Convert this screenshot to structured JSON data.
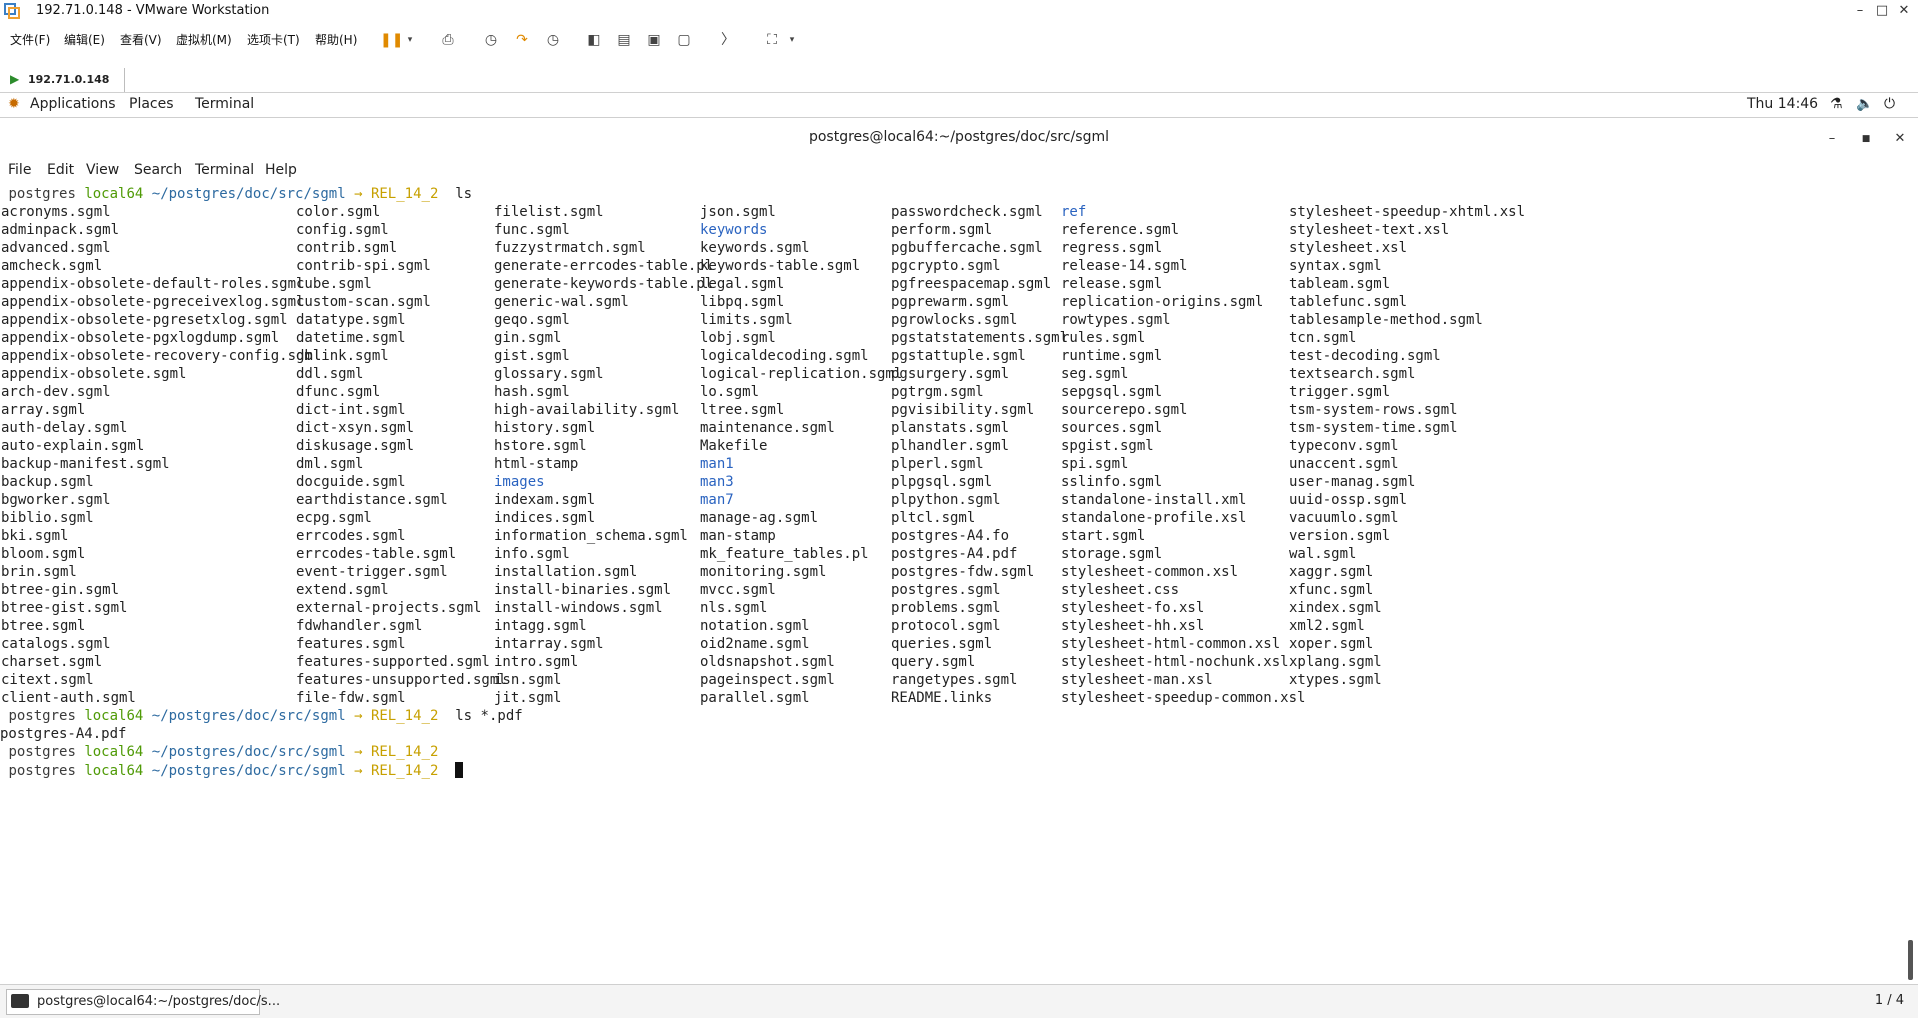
{
  "vmware": {
    "title": "192.71.0.148 - VMware Workstation",
    "menu": [
      "文件(F)",
      "编辑(E)",
      "查看(V)",
      "虚拟机(M)",
      "选项卡(T)",
      "帮助(H)"
    ],
    "tab": "192.71.0.148"
  },
  "gnome": {
    "applications": "Applications",
    "places": "Places",
    "terminal": "Terminal",
    "clock": "Thu 14:46"
  },
  "terminal": {
    "title": "postgres@local64:~/postgres/doc/src/sgml",
    "menu": [
      "File",
      "Edit",
      "View",
      "Search",
      "Terminal",
      "Help"
    ],
    "prompt": {
      "user": "postgres",
      "host": "local64",
      "path": "~/postgres/doc/src/sgml",
      "arrow": "→",
      "branch": "REL_14_2"
    },
    "cmd1": "ls",
    "cmd2": "ls *.pdf",
    "pdf_output": "postgres-A4.pdf",
    "ls_columns": [
      [
        "acronyms.sgml",
        "adminpack.sgml",
        "advanced.sgml",
        "amcheck.sgml",
        "appendix-obsolete-default-roles.sgml",
        "appendix-obsolete-pgreceivexlog.sgml",
        "appendix-obsolete-pgresetxlog.sgml",
        "appendix-obsolete-pgxlogdump.sgml",
        "appendix-obsolete-recovery-config.sgml",
        "appendix-obsolete.sgml",
        "arch-dev.sgml",
        "array.sgml",
        "auth-delay.sgml",
        "auto-explain.sgml",
        "backup-manifest.sgml",
        "backup.sgml",
        "bgworker.sgml",
        "biblio.sgml",
        "bki.sgml",
        "bloom.sgml",
        "brin.sgml",
        "btree-gin.sgml",
        "btree-gist.sgml",
        "btree.sgml",
        "catalogs.sgml",
        "charset.sgml",
        "citext.sgml",
        "client-auth.sgml"
      ],
      [
        "color.sgml",
        "config.sgml",
        "contrib.sgml",
        "contrib-spi.sgml",
        "cube.sgml",
        "custom-scan.sgml",
        "datatype.sgml",
        "datetime.sgml",
        "dblink.sgml",
        "ddl.sgml",
        "dfunc.sgml",
        "dict-int.sgml",
        "dict-xsyn.sgml",
        "diskusage.sgml",
        "dml.sgml",
        "docguide.sgml",
        "earthdistance.sgml",
        "ecpg.sgml",
        "errcodes.sgml",
        "errcodes-table.sgml",
        "event-trigger.sgml",
        "extend.sgml",
        "external-projects.sgml",
        "fdwhandler.sgml",
        "features.sgml",
        "features-supported.sgml",
        "features-unsupported.sgml",
        "file-fdw.sgml"
      ],
      [
        "filelist.sgml",
        "func.sgml",
        "fuzzystrmatch.sgml",
        "generate-errcodes-table.pl",
        "generate-keywords-table.pl",
        "generic-wal.sgml",
        "geqo.sgml",
        "gin.sgml",
        "gist.sgml",
        "glossary.sgml",
        "hash.sgml",
        "high-availability.sgml",
        "history.sgml",
        "hstore.sgml",
        "html-stamp",
        "images",
        "indexam.sgml",
        "indices.sgml",
        "information_schema.sgml",
        "info.sgml",
        "installation.sgml",
        "install-binaries.sgml",
        "install-windows.sgml",
        "intagg.sgml",
        "intarray.sgml",
        "intro.sgml",
        "isn.sgml",
        "jit.sgml"
      ],
      [
        "json.sgml",
        "keywords",
        "keywords.sgml",
        "keywords-table.sgml",
        "legal.sgml",
        "libpq.sgml",
        "limits.sgml",
        "lobj.sgml",
        "logicaldecoding.sgml",
        "logical-replication.sgml",
        "lo.sgml",
        "ltree.sgml",
        "maintenance.sgml",
        "Makefile",
        "man1",
        "man3",
        "man7",
        "manage-ag.sgml",
        "man-stamp",
        "mk_feature_tables.pl",
        "monitoring.sgml",
        "mvcc.sgml",
        "nls.sgml",
        "notation.sgml",
        "oid2name.sgml",
        "oldsnapshot.sgml",
        "pageinspect.sgml",
        "parallel.sgml"
      ],
      [
        "passwordcheck.sgml",
        "perform.sgml",
        "pgbuffercache.sgml",
        "pgcrypto.sgml",
        "pgfreespacemap.sgml",
        "pgprewarm.sgml",
        "pgrowlocks.sgml",
        "pgstatstatements.sgml",
        "pgstattuple.sgml",
        "pgsurgery.sgml",
        "pgtrgm.sgml",
        "pgvisibility.sgml",
        "planstats.sgml",
        "plhandler.sgml",
        "plperl.sgml",
        "plpgsql.sgml",
        "plpython.sgml",
        "pltcl.sgml",
        "postgres-A4.fo",
        "postgres-A4.pdf",
        "postgres-fdw.sgml",
        "postgres.sgml",
        "problems.sgml",
        "protocol.sgml",
        "queries.sgml",
        "query.sgml",
        "rangetypes.sgml",
        "README.links"
      ],
      [
        "ref",
        "reference.sgml",
        "regress.sgml",
        "release-14.sgml",
        "release.sgml",
        "replication-origins.sgml",
        "rowtypes.sgml",
        "rules.sgml",
        "runtime.sgml",
        "seg.sgml",
        "sepgsql.sgml",
        "sourcerepo.sgml",
        "sources.sgml",
        "spgist.sgml",
        "spi.sgml",
        "sslinfo.sgml",
        "standalone-install.xml",
        "standalone-profile.xsl",
        "start.sgml",
        "storage.sgml",
        "stylesheet-common.xsl",
        "stylesheet.css",
        "stylesheet-fo.xsl",
        "stylesheet-hh.xsl",
        "stylesheet-html-common.xsl",
        "stylesheet-html-nochunk.xsl",
        "stylesheet-man.xsl",
        "stylesheet-speedup-common.xsl"
      ],
      [
        "stylesheet-speedup-xhtml.xsl",
        "stylesheet-text.xsl",
        "stylesheet.xsl",
        "syntax.sgml",
        "tableam.sgml",
        "tablefunc.sgml",
        "tablesample-method.sgml",
        "tcn.sgml",
        "test-decoding.sgml",
        "textsearch.sgml",
        "trigger.sgml",
        "tsm-system-rows.sgml",
        "tsm-system-time.sgml",
        "typeconv.sgml",
        "unaccent.sgml",
        "user-manag.sgml",
        "uuid-ossp.sgml",
        "vacuumlo.sgml",
        "version.sgml",
        "wal.sgml",
        "xaggr.sgml",
        "xfunc.sgml",
        "xindex.sgml",
        "xml2.sgml",
        "xoper.sgml",
        "xplang.sgml",
        "xtypes.sgml"
      ]
    ],
    "directories": [
      "images",
      "keywords",
      "man1",
      "man3",
      "man7",
      "ref"
    ]
  },
  "taskbar": {
    "item": "postgres@local64:~/postgres/doc/s...",
    "workspace": "1 / 4"
  }
}
